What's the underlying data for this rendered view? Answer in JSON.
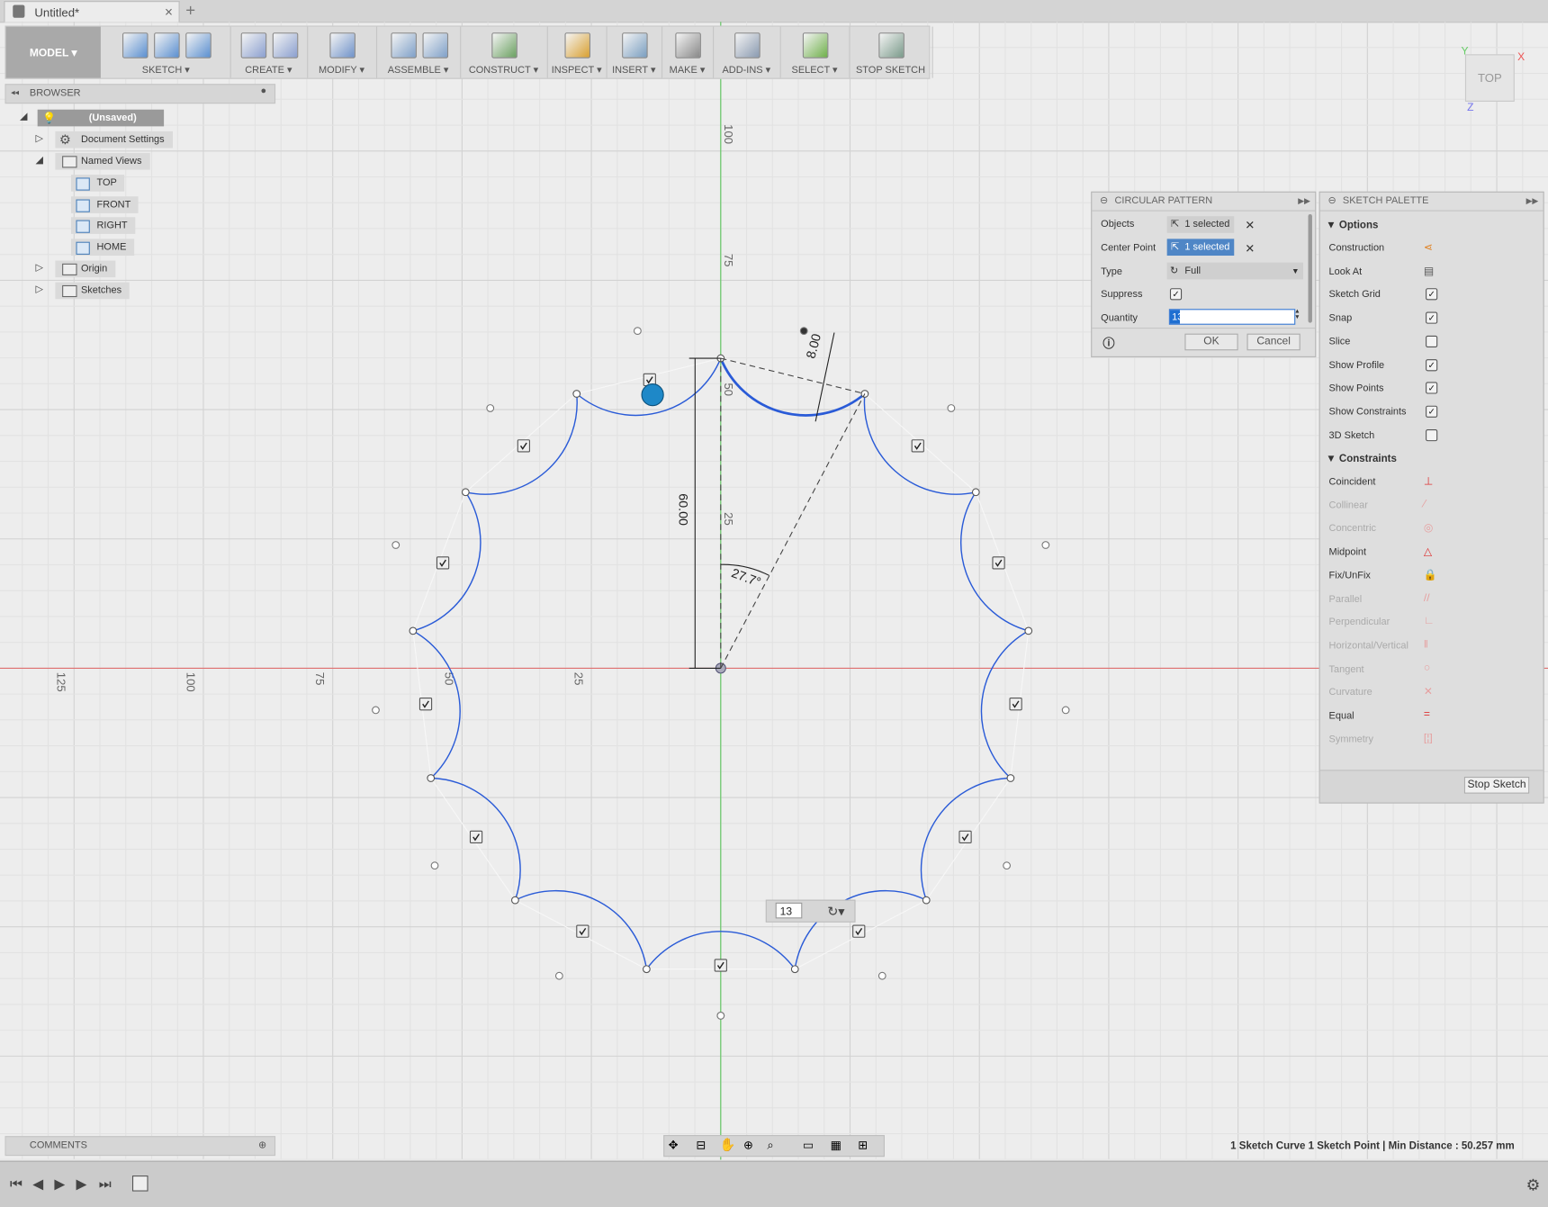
{
  "tab": {
    "title": "Untitled*",
    "close": "×",
    "new": "+"
  },
  "toolbar": {
    "model": "MODEL ▾",
    "groups": [
      {
        "label": "SKETCH ▾",
        "icons": [
          "create-sketch-icon",
          "line-icon",
          "rectangle-icon"
        ]
      },
      {
        "label": "CREATE ▾",
        "icons": [
          "extrude-icon",
          "form-icon"
        ]
      },
      {
        "label": "MODIFY ▾",
        "icons": [
          "press-pull-icon"
        ]
      },
      {
        "label": "ASSEMBLE ▾",
        "icons": [
          "new-component-icon",
          "joint-icon"
        ]
      },
      {
        "label": "CONSTRUCT ▾",
        "icons": [
          "offset-plane-icon"
        ]
      },
      {
        "label": "INSPECT ▾",
        "icons": [
          "measure-icon"
        ]
      },
      {
        "label": "INSERT ▾",
        "icons": [
          "insert-image-icon"
        ]
      },
      {
        "label": "MAKE ▾",
        "icons": [
          "3d-print-icon"
        ]
      },
      {
        "label": "ADD-INS ▾",
        "icons": [
          "scripts-icon"
        ]
      },
      {
        "label": "SELECT ▾",
        "icons": [
          "select-icon"
        ]
      },
      {
        "label": "STOP SKETCH",
        "icons": [
          "stop-sketch-icon"
        ]
      }
    ]
  },
  "browser": {
    "title": "BROWSER",
    "root": "(Unsaved)",
    "items": [
      "Document Settings",
      "Named Views",
      "TOP",
      "FRONT",
      "RIGHT",
      "HOME",
      "Origin",
      "Sketches"
    ]
  },
  "comments": {
    "title": "COMMENTS"
  },
  "circular_pattern": {
    "title": "CIRCULAR PATTERN",
    "objects_label": "Objects",
    "objects_value": "1 selected",
    "center_label": "Center Point",
    "center_value": "1 selected",
    "type_label": "Type",
    "type_value": "Full",
    "suppress_label": "Suppress",
    "suppress_checked": true,
    "quantity_label": "Quantity",
    "quantity_value": "13",
    "ok": "OK",
    "cancel": "Cancel"
  },
  "sketch_palette": {
    "title": "SKETCH PALETTE",
    "options_header": "Options",
    "options": [
      {
        "label": "Construction",
        "kind": "icon",
        "icon": "construction-icon"
      },
      {
        "label": "Look At",
        "kind": "icon",
        "icon": "look-at-icon"
      },
      {
        "label": "Sketch Grid",
        "kind": "check",
        "checked": true
      },
      {
        "label": "Snap",
        "kind": "check",
        "checked": true
      },
      {
        "label": "Slice",
        "kind": "check",
        "checked": false
      },
      {
        "label": "Show Profile",
        "kind": "check",
        "checked": true
      },
      {
        "label": "Show Points",
        "kind": "check",
        "checked": true
      },
      {
        "label": "Show Constraints",
        "kind": "check",
        "checked": true
      },
      {
        "label": "3D Sketch",
        "kind": "check",
        "checked": false
      }
    ],
    "constraints_header": "Constraints",
    "constraints": [
      {
        "label": "Coincident",
        "enabled": true,
        "icon": "coincident-icon",
        "glyph": "⊥"
      },
      {
        "label": "Collinear",
        "enabled": false,
        "icon": "collinear-icon",
        "glyph": "⁄"
      },
      {
        "label": "Concentric",
        "enabled": false,
        "icon": "concentric-icon",
        "glyph": "◎"
      },
      {
        "label": "Midpoint",
        "enabled": true,
        "icon": "midpoint-icon",
        "glyph": "△"
      },
      {
        "label": "Fix/UnFix",
        "enabled": true,
        "icon": "lock-icon",
        "glyph": "🔒"
      },
      {
        "label": "Parallel",
        "enabled": false,
        "icon": "parallel-icon",
        "glyph": "//"
      },
      {
        "label": "Perpendicular",
        "enabled": false,
        "icon": "perpendicular-icon",
        "glyph": "∟"
      },
      {
        "label": "Horizontal/Vertical",
        "enabled": false,
        "icon": "horizontal-vertical-icon",
        "glyph": "‖"
      },
      {
        "label": "Tangent",
        "enabled": false,
        "icon": "tangent-icon",
        "glyph": "○"
      },
      {
        "label": "Curvature",
        "enabled": false,
        "icon": "curvature-icon",
        "glyph": "✕"
      },
      {
        "label": "Equal",
        "enabled": true,
        "icon": "equal-icon",
        "glyph": "="
      },
      {
        "label": "Symmetry",
        "enabled": false,
        "icon": "symmetry-icon",
        "glyph": "[¦]"
      }
    ],
    "stop": "Stop Sketch"
  },
  "canvas": {
    "y_ticks": [
      "100",
      "75",
      "50",
      "25"
    ],
    "x_ticks": [
      "125",
      "100",
      "75",
      "50",
      "25"
    ],
    "dim_height": "60.00",
    "dim_radius": "8.00",
    "dim_angle": "27.7°",
    "quantity_inline": "13",
    "viewcube": "TOP",
    "axis_x": "X",
    "axis_y": "Y",
    "axis_z": "Z"
  },
  "colors": {
    "curve": "#2a5bd7",
    "x_axis": "#e07070",
    "y_axis": "#5cc65c",
    "selected_field": "#4f86c6"
  },
  "status": {
    "text": "1 Sketch Curve 1 Sketch Point | Min Distance : 50.257 mm"
  }
}
